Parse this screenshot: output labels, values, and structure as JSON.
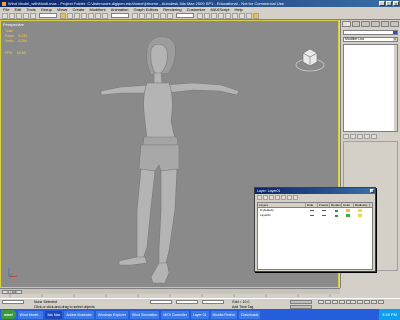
{
  "window": {
    "title": "Wind Model_withMoidi.max   - Project Folder: C:\\Ashmoore.digipen.edu\\home\\j\\rhorne   - Autodesk 3ds Max  2009 SP1  - Educational - Not for Commercial Use"
  },
  "menu": [
    "File",
    "Edit",
    "Tools",
    "Group",
    "Views",
    "Create",
    "Modifiers",
    "Animation",
    "Graph Editors",
    "Rendering",
    "Customize",
    "MAXScript",
    "Help"
  ],
  "viewport": {
    "label": "Perspective",
    "stats": [
      {
        "name": "Total",
        "value": ""
      },
      {
        "name": "Polys:",
        "value": "6,232"
      },
      {
        "name": "Verts:",
        "value": "3,294"
      }
    ],
    "fps_label": "FPS:",
    "fps_value": "60.58"
  },
  "command_panel": {
    "modifier_list": "Modifier List"
  },
  "layer_window": {
    "title": "Layer: Layer01",
    "columns": [
      "Layers",
      "Hide",
      "Freeze",
      "Render",
      "Color",
      "Radiosity"
    ],
    "rows": [
      {
        "name": "0 (default)"
      },
      {
        "name": "Layer01"
      }
    ]
  },
  "timeline": {
    "frame_label": "0 / 100"
  },
  "status": {
    "selection": "None Selected",
    "prompt": "Click or click-and-drag to select objects",
    "add_time_tag": "Add Time Tag",
    "grid": "Grid = 10.0"
  },
  "taskbar": {
    "start": "start",
    "items": [
      "Wind Model...",
      "3ds Max",
      "Adobe Illustrator",
      "Windows Explorer",
      "Wind Simulation",
      "MIDI Controller",
      "Layer 01",
      "Mozilla Firefox",
      "Downloads"
    ],
    "active_index": 1,
    "clock": "3:59 PM"
  },
  "colors": {
    "title_bar": "#0a246a",
    "viewport_bg": "#8a8a8a",
    "taskbar": "#245edb",
    "active_border": "#d8d240"
  }
}
